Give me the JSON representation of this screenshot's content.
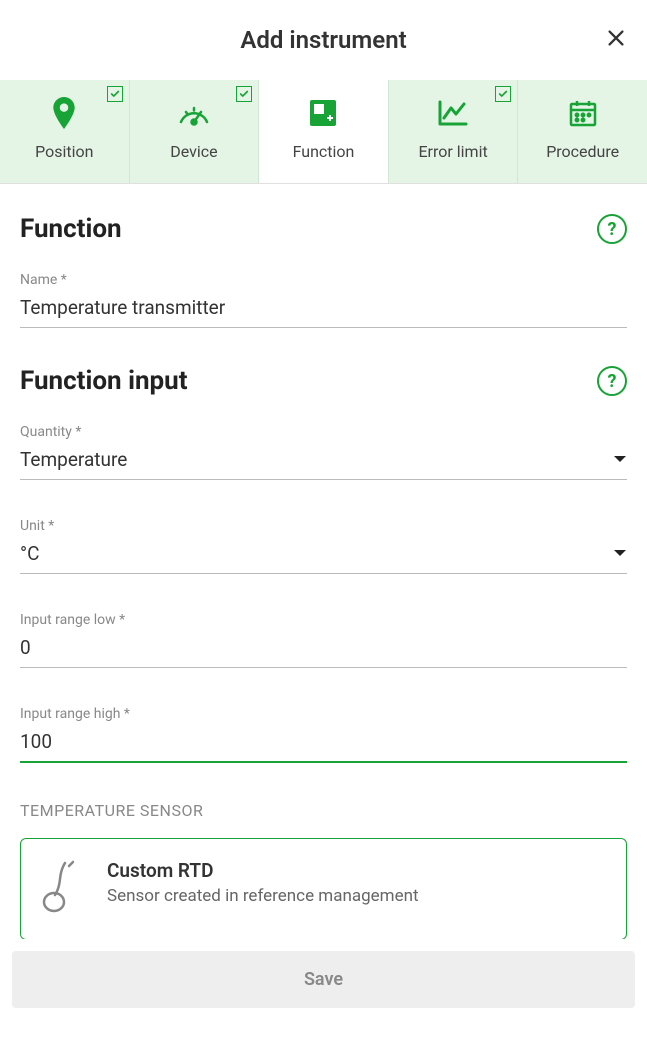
{
  "header": {
    "title": "Add instrument"
  },
  "tabs": [
    {
      "id": "position",
      "label": "Position",
      "icon": "pin",
      "checked": true,
      "active": false
    },
    {
      "id": "device",
      "label": "Device",
      "icon": "gauge",
      "checked": true,
      "active": false
    },
    {
      "id": "function",
      "label": "Function",
      "icon": "function",
      "checked": false,
      "active": true
    },
    {
      "id": "error-limit",
      "label": "Error limit",
      "icon": "chart-line",
      "checked": true,
      "active": false
    },
    {
      "id": "procedure",
      "label": "Procedure",
      "icon": "calendar",
      "checked": false,
      "active": false
    }
  ],
  "sections": {
    "function": {
      "title": "Function",
      "name_label": "Name *",
      "name_value": "Temperature transmitter"
    },
    "function_input": {
      "title": "Function input",
      "quantity_label": "Quantity *",
      "quantity_value": "Temperature",
      "unit_label": "Unit *",
      "unit_value": "°C",
      "range_low_label": "Input range low *",
      "range_low_value": "0",
      "range_high_label": "Input range high *",
      "range_high_value": "100"
    },
    "temperature_sensor": {
      "header": "TEMPERATURE SENSOR",
      "card_title": "Custom RTD",
      "card_desc": "Sensor created in reference management"
    }
  },
  "footer": {
    "save_label": "Save"
  },
  "colors": {
    "accent": "#17a336",
    "tab_bg": "#e4f4e5"
  }
}
